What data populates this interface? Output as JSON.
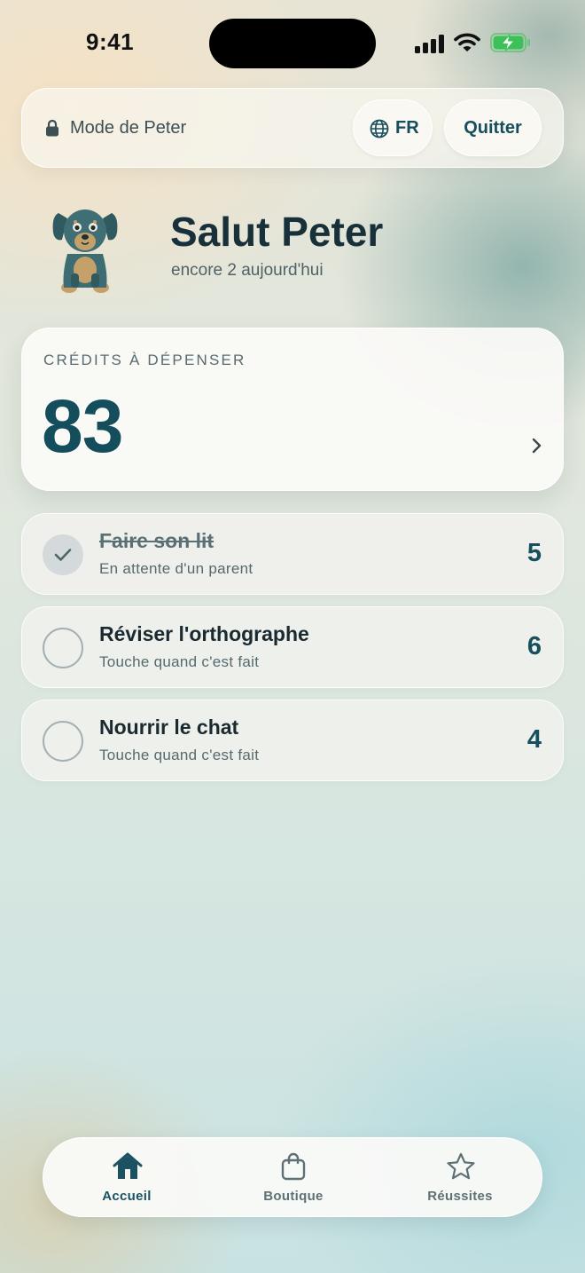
{
  "status_bar": {
    "time": "9:41"
  },
  "top_bar": {
    "mode_label": "Mode de Peter",
    "lang_label": "FR",
    "quit_label": "Quitter"
  },
  "header": {
    "greeting": "Salut Peter",
    "subtitle": "encore 2 aujourd'hui"
  },
  "credits": {
    "label": "CRÉDITS À DÉPENSER",
    "value": "83"
  },
  "tasks": [
    {
      "title": "Faire son lit",
      "subtitle": "En attente d'un parent",
      "points": "5",
      "done": true
    },
    {
      "title": "Réviser l'orthographe",
      "subtitle": "Touche quand c'est fait",
      "points": "6",
      "done": false
    },
    {
      "title": "Nourrir le chat",
      "subtitle": "Touche quand c'est fait",
      "points": "4",
      "done": false
    }
  ],
  "tab_bar": {
    "items": [
      {
        "label": "Accueil",
        "icon": "home-icon",
        "active": true
      },
      {
        "label": "Boutique",
        "icon": "shopping-bag-icon",
        "active": false
      },
      {
        "label": "Réussites",
        "icon": "star-icon",
        "active": false
      }
    ]
  },
  "colors": {
    "accent": "#144e5d",
    "text_dark": "#17303a",
    "battery_green": "#3cc158"
  }
}
